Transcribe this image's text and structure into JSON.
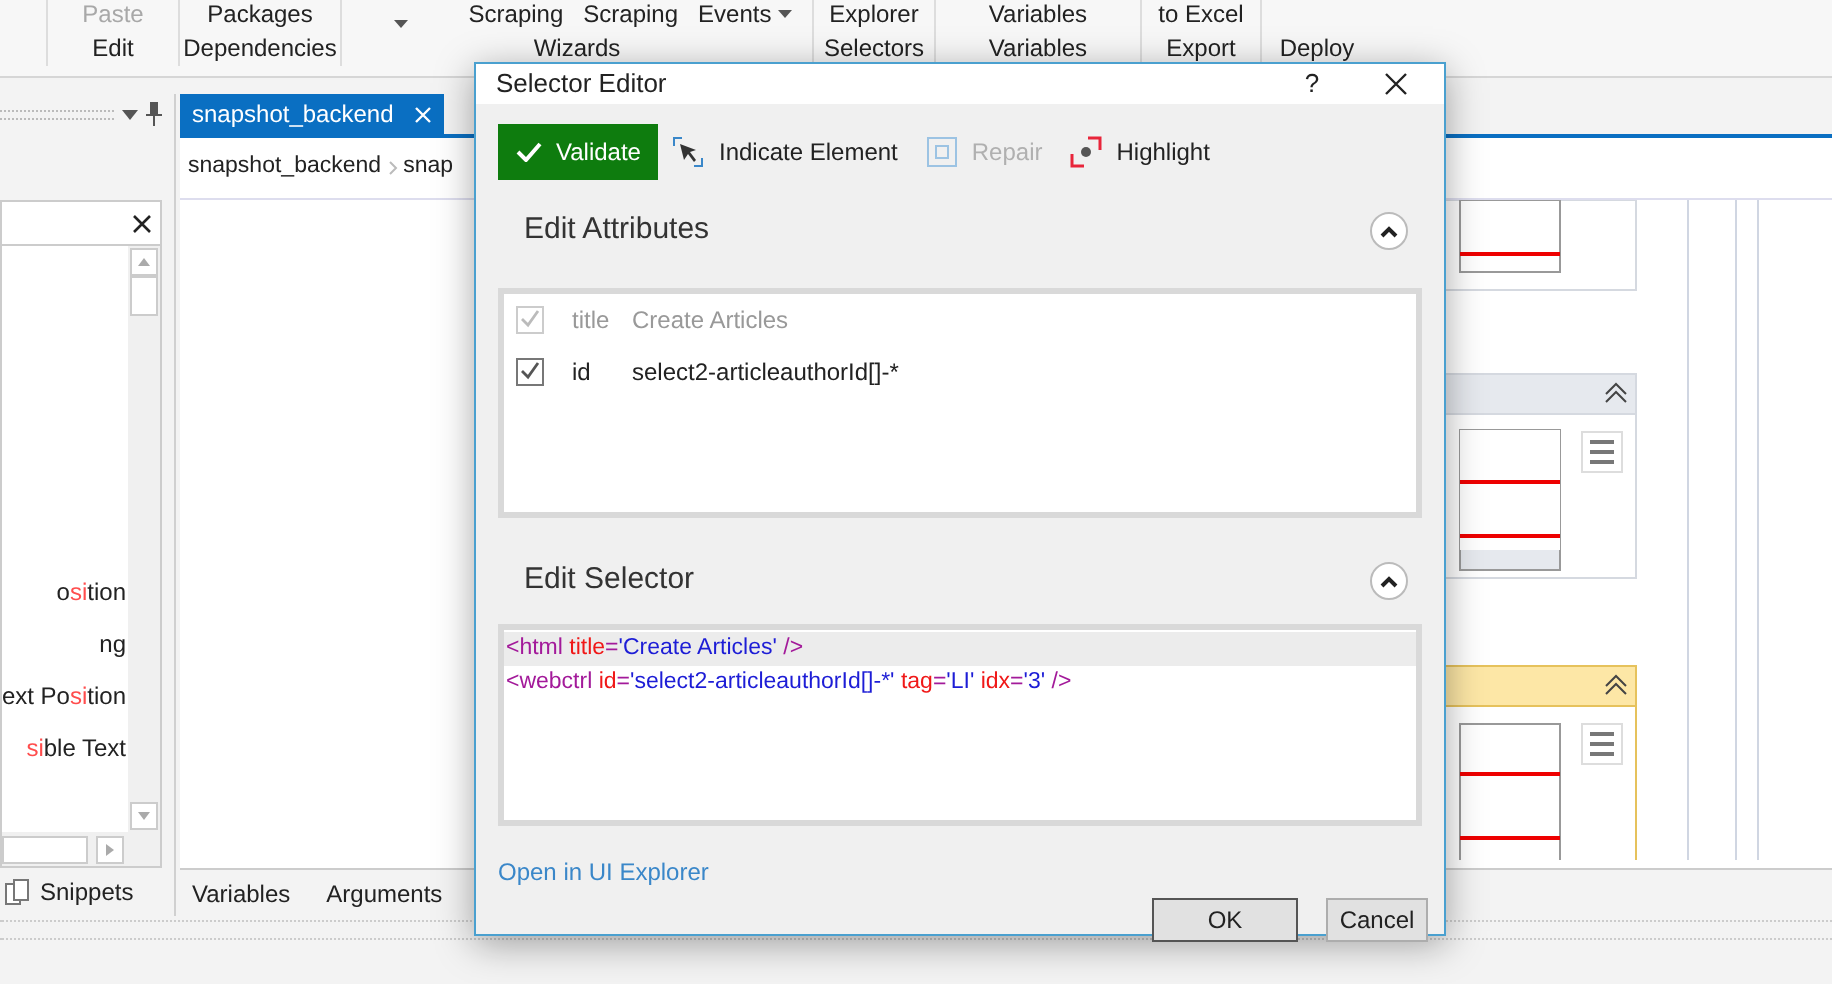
{
  "ribbon": {
    "groups": [
      {
        "items": [
          {
            "text": "Paste",
            "disabled": true
          }
        ],
        "label": "Edit"
      },
      {
        "items": [
          {
            "text": "Packages",
            "disabled": false
          }
        ],
        "label": "Dependencies"
      },
      {
        "items": [
          {
            "dropdown": true,
            "disabled": false
          },
          {
            "text": "Scraping",
            "disabled": false
          },
          {
            "text": "Scraping",
            "disabled": false
          },
          {
            "text": "Events",
            "dropdown": true,
            "disabled": false
          }
        ],
        "label": "Wizards"
      },
      {
        "items": [
          {
            "text": "Explorer",
            "disabled": false
          }
        ],
        "label": "Selectors"
      },
      {
        "items": [
          {
            "text": "Variables",
            "disabled": false
          }
        ],
        "label": "Variables"
      },
      {
        "items": [
          {
            "text": "to Excel",
            "disabled": false
          }
        ],
        "label": "Export"
      },
      {
        "label": "Deploy"
      }
    ]
  },
  "activities_panel": {
    "items": [
      {
        "parts": [
          {
            "text": "o",
            "match": false
          },
          {
            "text": "si",
            "match": true
          },
          {
            "text": "tion",
            "match": false
          }
        ]
      },
      {
        "parts": [
          {
            "text": "ng",
            "match": false
          }
        ]
      },
      {
        "parts": [
          {
            "text": "ext Po",
            "match": false
          },
          {
            "text": "si",
            "match": true
          },
          {
            "text": "tion",
            "match": false
          }
        ]
      },
      {
        "parts": [
          {
            "text": "si",
            "match": true
          },
          {
            "text": "ble Text",
            "match": false
          }
        ]
      }
    ],
    "bottom_tab": "Snippets"
  },
  "document": {
    "tab": {
      "label": "snapshot_backend",
      "selected": true
    },
    "breadcrumb": [
      "snapshot_backend",
      "snap"
    ],
    "bottom_tabs": [
      "Variables",
      "Arguments"
    ]
  },
  "dialog": {
    "title": "Selector Editor",
    "help": "?",
    "toolbar": [
      {
        "kind": "validate",
        "label": "Validate",
        "disabled": false
      },
      {
        "kind": "indicate",
        "label": "Indicate Element",
        "disabled": false
      },
      {
        "kind": "repair",
        "label": "Repair",
        "disabled": true
      },
      {
        "kind": "highlight",
        "label": "Highlight",
        "disabled": false
      }
    ],
    "attributes": {
      "heading": "Edit Attributes",
      "expanded": true,
      "rows": [
        {
          "name": "title",
          "value": "Create Articles",
          "checked": true,
          "disabled": true
        },
        {
          "name": "id",
          "value": "select2-articleauthorId[]-*",
          "checked": true,
          "disabled": false
        }
      ]
    },
    "selector": {
      "heading": "Edit Selector",
      "expanded": true,
      "lines": [
        {
          "current": true,
          "tokens": [
            {
              "kind": "tag",
              "text": "<html "
            },
            {
              "kind": "attr",
              "text": "title"
            },
            {
              "kind": "punct",
              "text": "="
            },
            {
              "kind": "value",
              "text": "'Create Articles'"
            },
            {
              "kind": "tag",
              "text": " />"
            }
          ]
        },
        {
          "current": false,
          "tokens": [
            {
              "kind": "tag",
              "text": "<webctrl "
            },
            {
              "kind": "attr",
              "text": "id"
            },
            {
              "kind": "punct",
              "text": "="
            },
            {
              "kind": "value",
              "text": "'select2-articleauthorId[]-*'"
            },
            {
              "kind": "attr",
              "text": " tag"
            },
            {
              "kind": "punct",
              "text": "="
            },
            {
              "kind": "value",
              "text": "'LI'"
            },
            {
              "kind": "attr",
              "text": " idx"
            },
            {
              "kind": "punct",
              "text": "="
            },
            {
              "kind": "value",
              "text": "'3'"
            },
            {
              "kind": "tag",
              "text": " />"
            }
          ]
        }
      ]
    },
    "link": "Open in UI Explorer",
    "buttons": [
      "OK",
      "Cancel"
    ]
  }
}
